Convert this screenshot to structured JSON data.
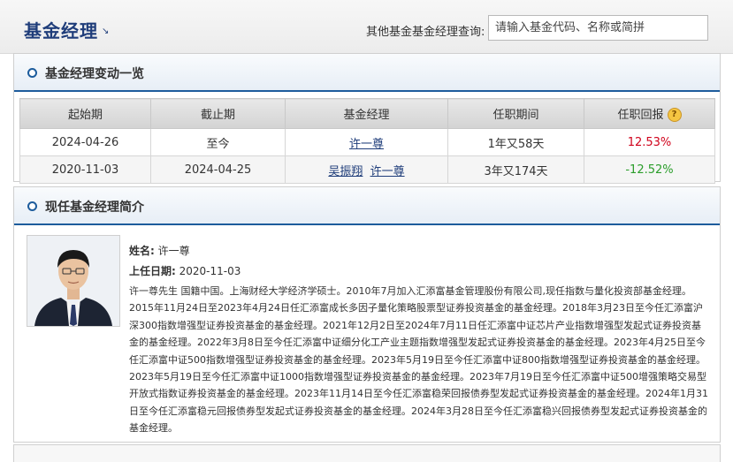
{
  "header": {
    "title": "基金经理",
    "search_label": "其他基金基金经理查询:",
    "search_placeholder": "请输入基金代码、名称或简拼"
  },
  "changes": {
    "title": "基金经理变动一览",
    "columns": [
      "起始期",
      "截止期",
      "基金经理",
      "任职期间",
      "任职回报"
    ],
    "rows": [
      {
        "start": "2024-04-26",
        "end": "至今",
        "managers": [
          "许一尊"
        ],
        "duration": "1年又58天",
        "return": "12.53%"
      },
      {
        "start": "2020-11-03",
        "end": "2024-04-25",
        "managers": [
          "吴振翔",
          "许一尊"
        ],
        "duration": "3年又174天",
        "return": "-12.52%"
      }
    ]
  },
  "profile": {
    "title": "现任基金经理简介",
    "name_label": "姓名:",
    "name": "许一尊",
    "date_label": "上任日期:",
    "date": "2020-11-03",
    "bio": "许一尊先生 国籍中国。上海财经大学经济学硕士。2010年7月加入汇添富基金管理股份有限公司,现任指数与量化投资部基金经理。2015年11月24日至2023年4月24日任汇添富成长多因子量化策略股票型证券投资基金的基金经理。2018年3月23日至今任汇添富沪深300指数增强型证券投资基金的基金经理。2021年12月2日至2024年7月11日任汇添富中证芯片产业指数增强型发起式证券投资基金的基金经理。2022年3月8日至今任汇添富中证细分化工产业主题指数增强型发起式证券投资基金的基金经理。2023年4月25日至今任汇添富中证500指数增强型证券投资基金的基金经理。2023年5月19日至今任汇添富中证800指数增强型证券投资基金的基金经理。2023年5月19日至今任汇添富中证1000指数增强型证券投资基金的基金经理。2023年7月19日至今任汇添富中证500增强策略交易型开放式指数证券投资基金的基金经理。2023年11月14日至今任汇添富稳荣回报债券型发起式证券投资基金的基金经理。2024年1月31日至今任汇添富稳元回报债券型发起式证券投资基金的基金经理。2024年3月28日至今任汇添富稳兴回报债券型发起式证券投资基金的基金经理。"
  },
  "colors": {
    "accent": "#1d5c9c",
    "title": "#1f3d7a",
    "positive": "#d0021b",
    "negative": "#2a9d2a"
  },
  "icons": [
    "arrow-icon",
    "circle-bullet-icon",
    "help-icon",
    "manager-photo"
  ]
}
